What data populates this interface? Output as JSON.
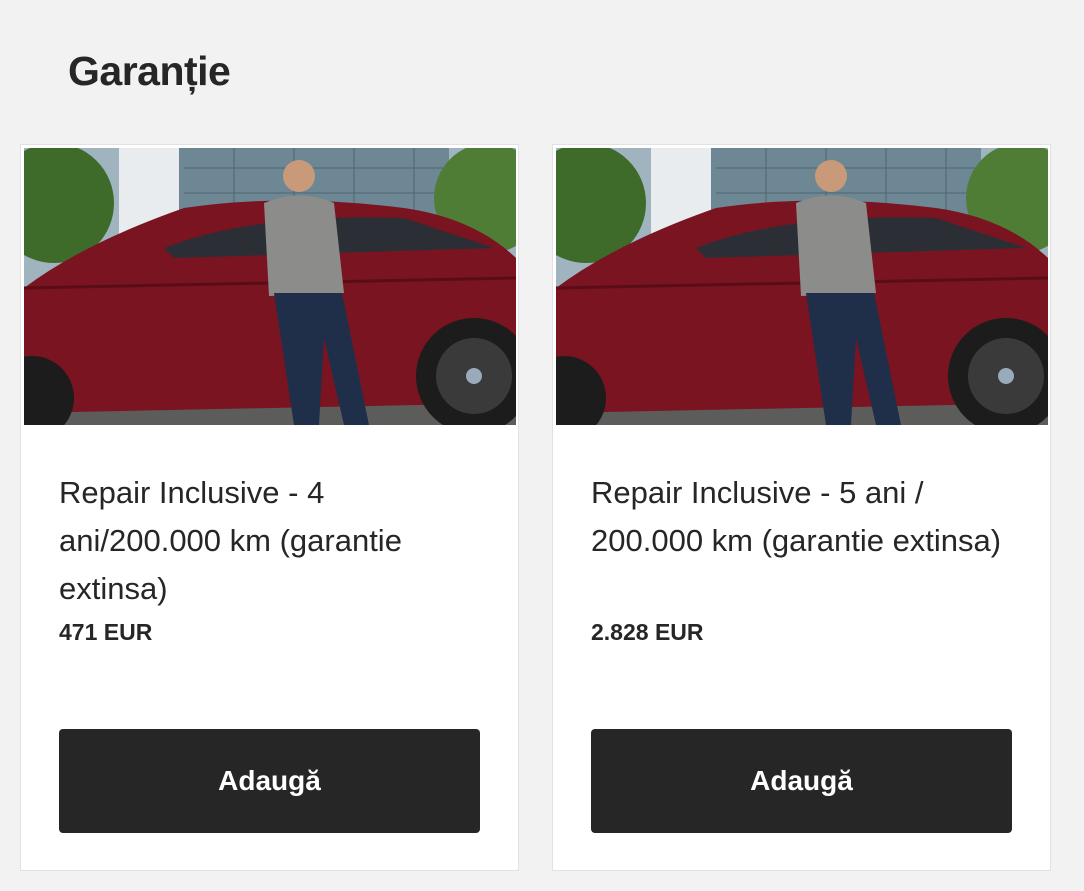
{
  "section": {
    "title": "Garanție"
  },
  "cards": [
    {
      "image_alt": "car-with-man-photo",
      "title": "Repair Inclusive - 4 ani/200.000 km (garantie extinsa)",
      "price": "471 EUR",
      "button_label": "Adaugă"
    },
    {
      "image_alt": "car-with-man-photo",
      "title": "Repair Inclusive - 5 ani / 200.000 km (garantie extinsa)",
      "price": "2.828 EUR",
      "button_label": "Adaugă"
    }
  ],
  "colors": {
    "page_background": "#f2f2f2",
    "card_background": "#ffffff",
    "button_background": "#262626",
    "button_text": "#ffffff",
    "text": "#262626",
    "car_red": "#7a1420"
  }
}
